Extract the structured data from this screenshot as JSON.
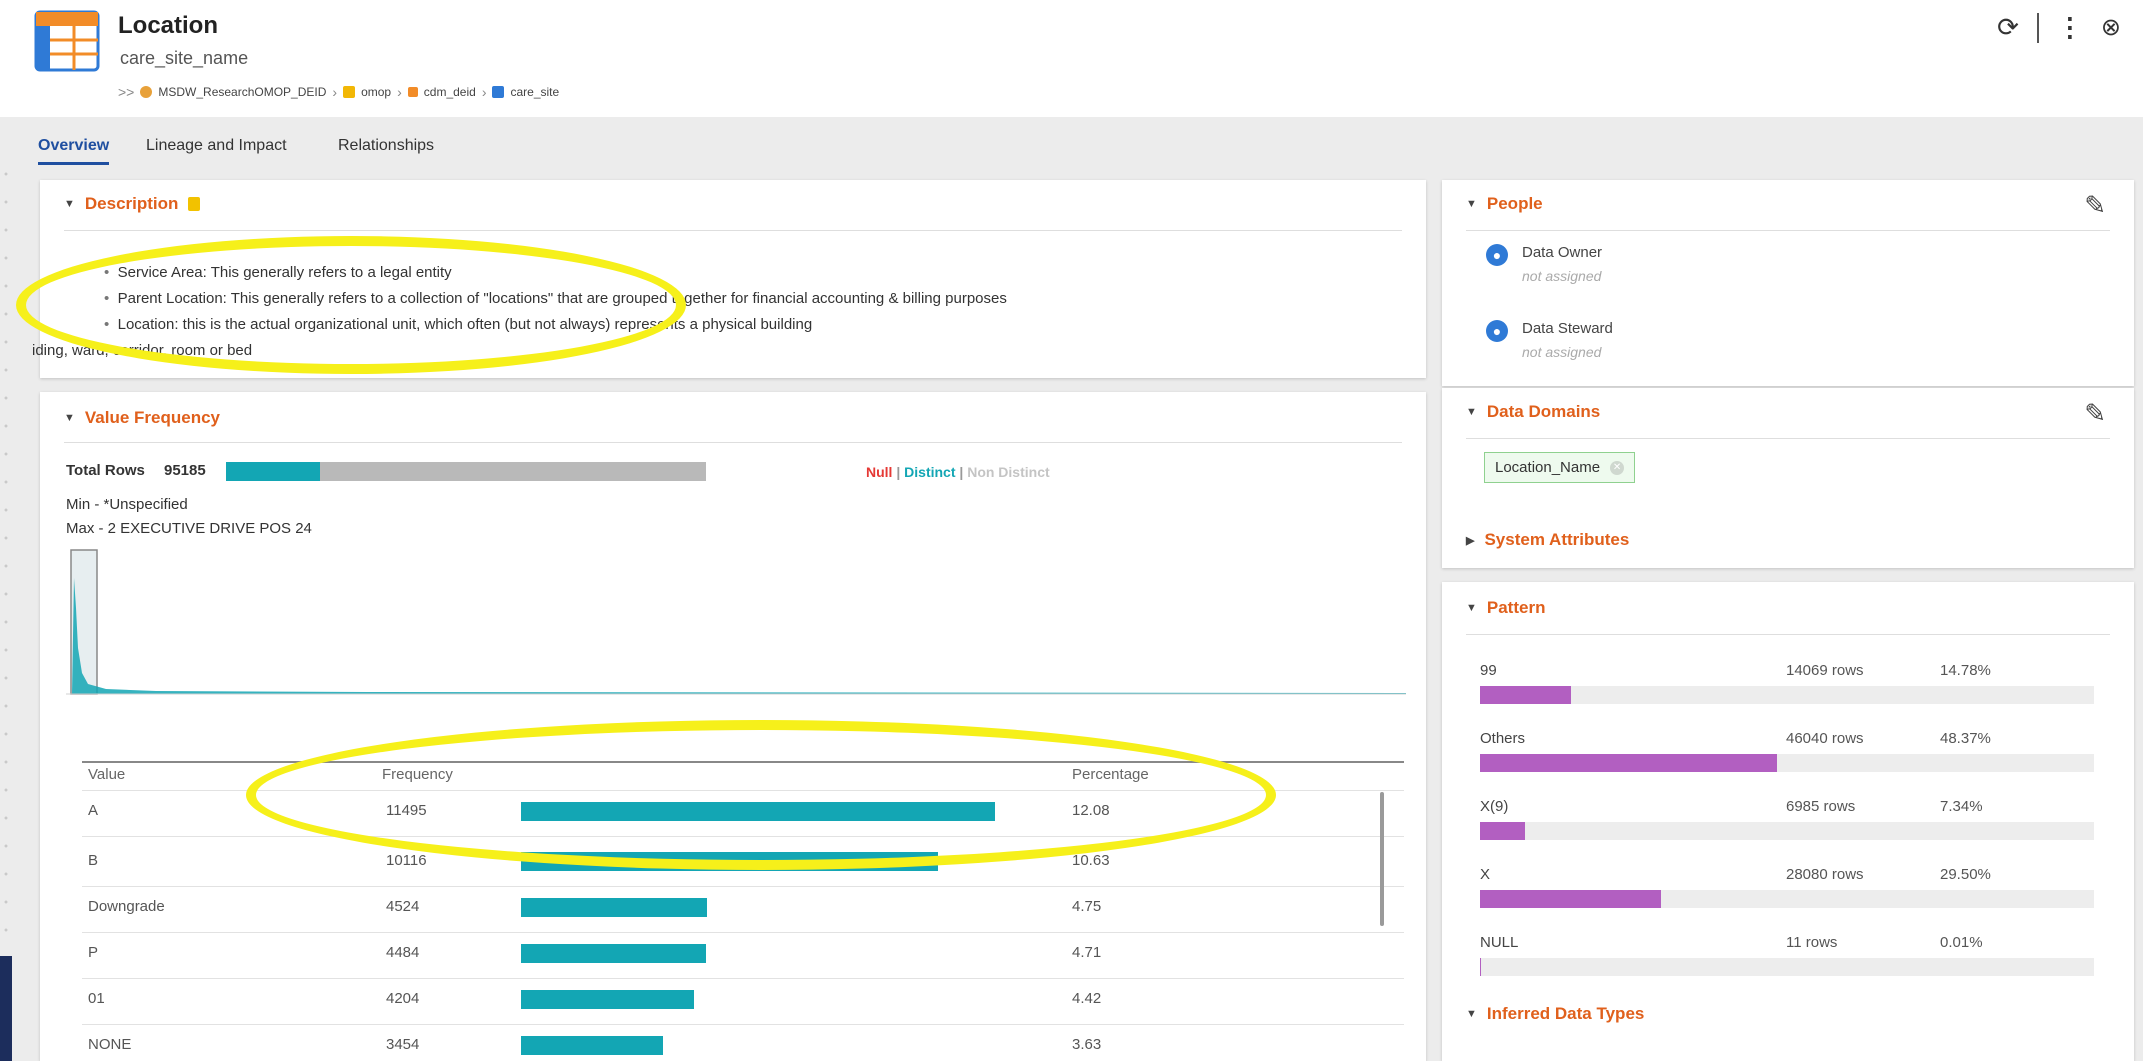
{
  "header": {
    "title": "Location",
    "subtitle": "care_site_name",
    "breadcrumb": {
      "prefix": ">>",
      "items": [
        "MSDW_ResearchOMOP_DEID",
        "omop",
        "cdm_deid",
        "care_site"
      ]
    },
    "actions": [
      "refresh-icon",
      "more-vertical-icon",
      "close-circle-icon"
    ]
  },
  "tabs": [
    {
      "label": "Overview",
      "active": true
    },
    {
      "label": "Lineage and Impact",
      "active": false
    },
    {
      "label": "Relationships",
      "active": false
    }
  ],
  "description": {
    "title": "Description",
    "lines": [
      "Service Area: This generally refers to a legal entity",
      "Parent Location: This generally refers to a collection of \"locations\" that are grouped together for financial accounting & billing purposes",
      "Location: this is the actual organizational unit, which often (but not always) represents a physical building",
      "iding, ward, corridor, room or bed"
    ]
  },
  "value_frequency": {
    "title": "Value Frequency",
    "total_rows_label": "Total Rows",
    "total_rows": "95185",
    "distinct_fraction": 0.195,
    "legend": {
      "null": "Null",
      "sep": "|",
      "distinct": "Distinct",
      "non_distinct": "Non Distinct"
    },
    "min_line": "Min - *Unspecified",
    "max_line": "Max -  2 EXECUTIVE DRIVE POS 24",
    "columns": {
      "value": "Value",
      "frequency": "Frequency",
      "percentage": "Percentage"
    },
    "rows": [
      {
        "value": "A",
        "frequency": "11495",
        "percentage": "12.08",
        "bar": 12.08
      },
      {
        "value": "B",
        "frequency": "10116",
        "percentage": "10.63",
        "bar": 10.63
      },
      {
        "value": "Downgrade",
        "frequency": "4524",
        "percentage": "4.75",
        "bar": 4.75
      },
      {
        "value": "P",
        "frequency": "4484",
        "percentage": "4.71",
        "bar": 4.71
      },
      {
        "value": "01",
        "frequency": "4204",
        "percentage": "4.42",
        "bar": 4.42
      },
      {
        "value": "NONE",
        "frequency": "3454",
        "percentage": "3.63",
        "bar": 3.63
      }
    ]
  },
  "people": {
    "title": "People",
    "data_owner_label": "Data Owner",
    "data_owner_value": "not assigned",
    "data_steward_label": "Data Steward",
    "data_steward_value": "not assigned"
  },
  "data_domains": {
    "title": "Data Domains",
    "chip": "Location_Name"
  },
  "system_attributes": {
    "title": "System Attributes"
  },
  "pattern": {
    "title": "Pattern",
    "rows": [
      {
        "label": "99",
        "rows": "14069 rows",
        "pct": "14.78%",
        "value": 14.78
      },
      {
        "label": "Others",
        "rows": "46040 rows",
        "pct": "48.37%",
        "value": 48.37
      },
      {
        "label": "X(9)",
        "rows": "6985 rows",
        "pct": "7.34%",
        "value": 7.34
      },
      {
        "label": "X",
        "rows": "28080 rows",
        "pct": "29.50%",
        "value": 29.5
      },
      {
        "label": "NULL",
        "rows": "11 rows",
        "pct": "0.01%",
        "value": 0.01
      }
    ]
  },
  "inferred_data_types": {
    "title": "Inferred Data Types"
  },
  "colors": {
    "accent": "#e0601c",
    "link": "#1f4fa0",
    "teal": "#13a6b4",
    "purple": "#b25fc1",
    "highlight": "#f6f01a"
  }
}
